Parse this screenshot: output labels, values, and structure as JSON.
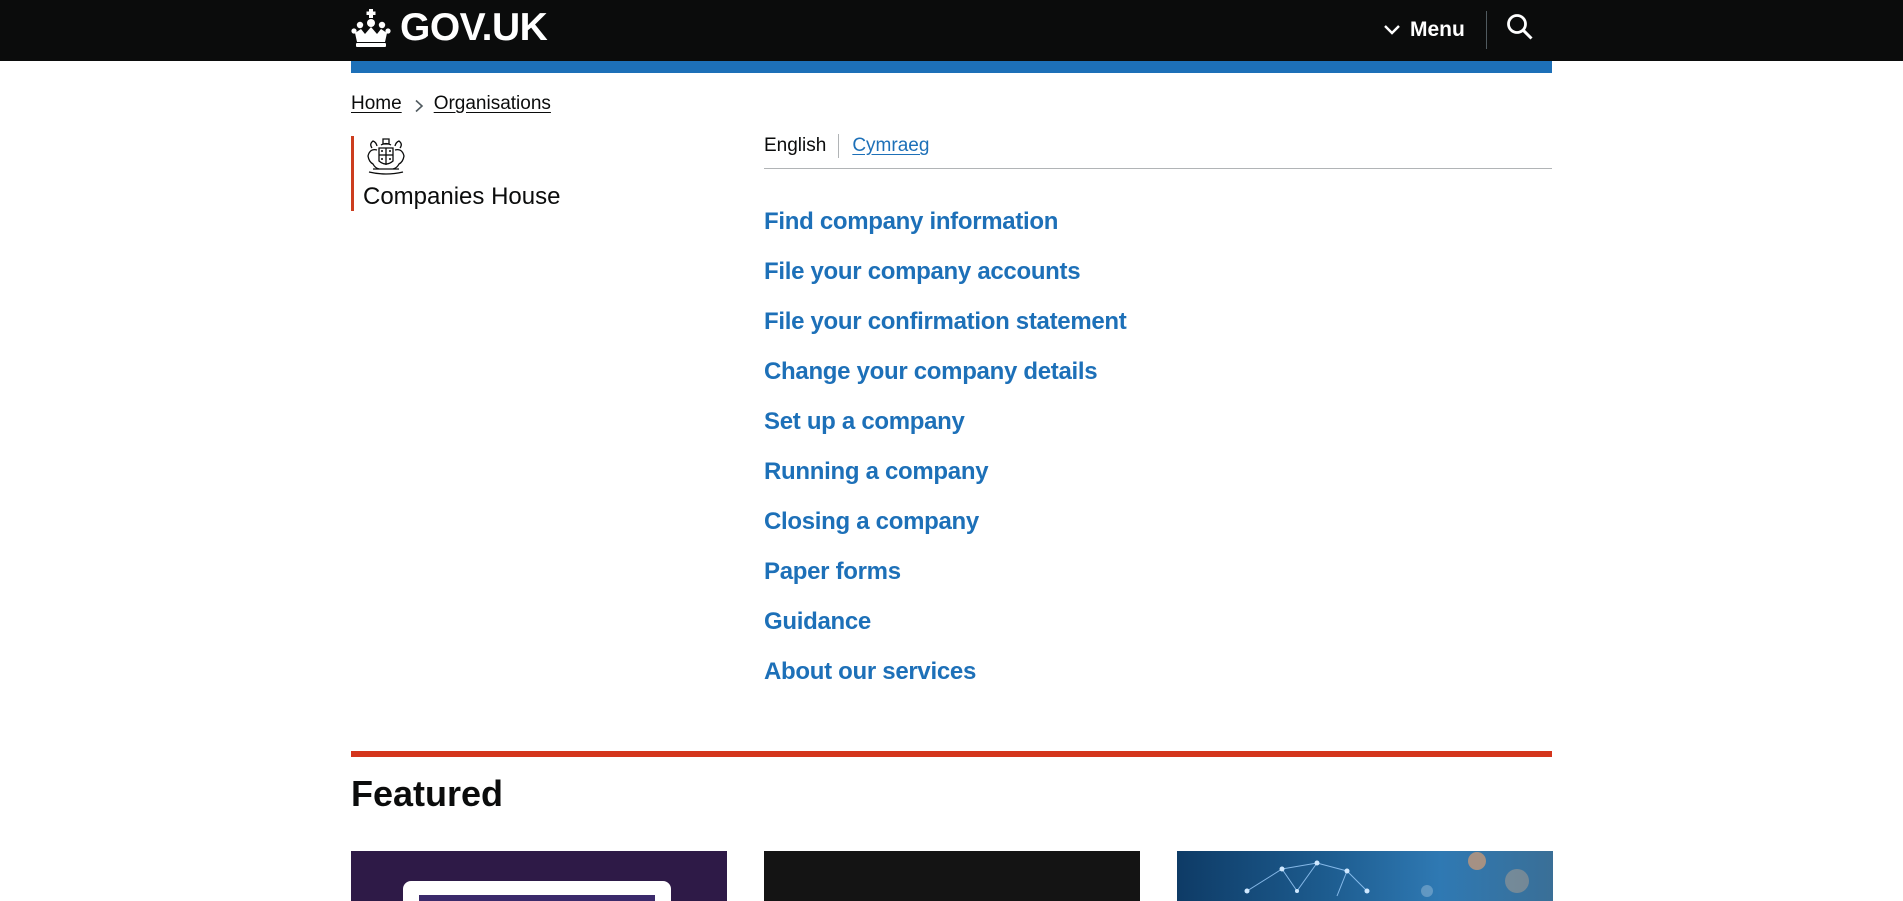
{
  "header": {
    "logo_text": "GOV.UK",
    "menu_label": "Menu",
    "search_label": "Search GOV.UK"
  },
  "breadcrumb": {
    "items": [
      "Home",
      "Organisations"
    ]
  },
  "organisation": {
    "name": "Companies House",
    "crest": "royal-coat-of-arms"
  },
  "language": {
    "current": "English",
    "alternate": "Cymraeg"
  },
  "links": [
    "Find company information",
    "File your company accounts",
    "File your confirmation statement",
    "Change your company details",
    "Set up a company",
    "Running a company",
    "Closing a company",
    "Paper forms",
    "Guidance",
    "About our services"
  ],
  "featured": {
    "title": "Featured"
  },
  "colors": {
    "header_bg": "#0b0c0c",
    "brand_blue": "#1d70b8",
    "org_red": "#cc3d1e",
    "section_rule": "#d4351c",
    "link": "#1d70b8"
  }
}
